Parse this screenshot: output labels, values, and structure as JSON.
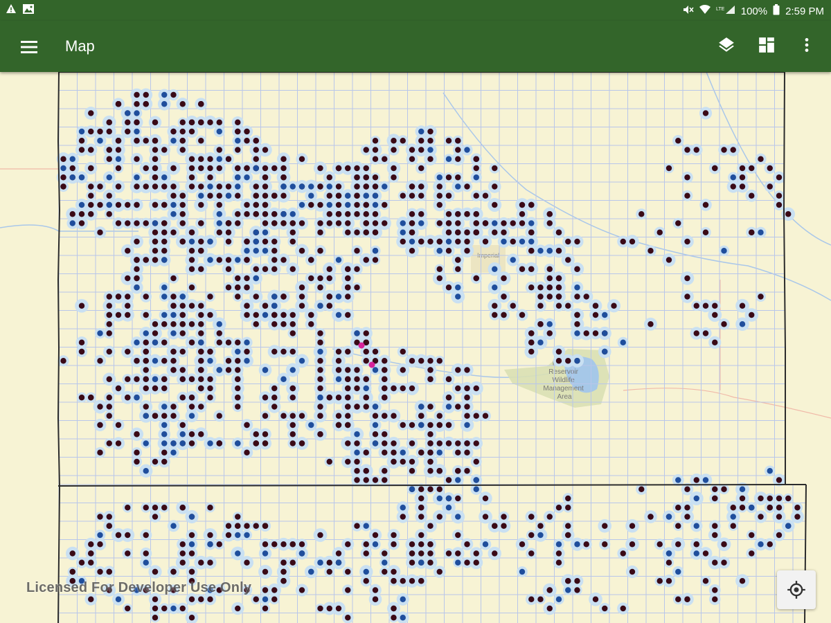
{
  "status_bar": {
    "battery": "100%",
    "time": "2:59 PM"
  },
  "app_bar": {
    "title": "Map",
    "icons": [
      "menu-icon",
      "layers-icon",
      "basemap-gallery-icon",
      "more-vert-icon"
    ]
  },
  "map": {
    "watermark": "Licensed For Developer Use Only",
    "wildlife_area_label": [
      "Enders",
      "Reservoir",
      "Wildlife",
      "Management",
      "Area"
    ],
    "town_label": "Imperial",
    "colors": {
      "background": "#f7f3d4",
      "section_grid": "#b8c6ea",
      "county_border": "#2b2b2b",
      "buffer": "#c9e0f2",
      "well_dark": "#3a0a16",
      "well_blue": "#1f4e9c",
      "well_magenta": "#d6239a",
      "reservoir": "#a6c8e8",
      "wildlife_area": "#d9e0b4"
    }
  },
  "locate_button": {
    "icon": "my-location-icon"
  }
}
